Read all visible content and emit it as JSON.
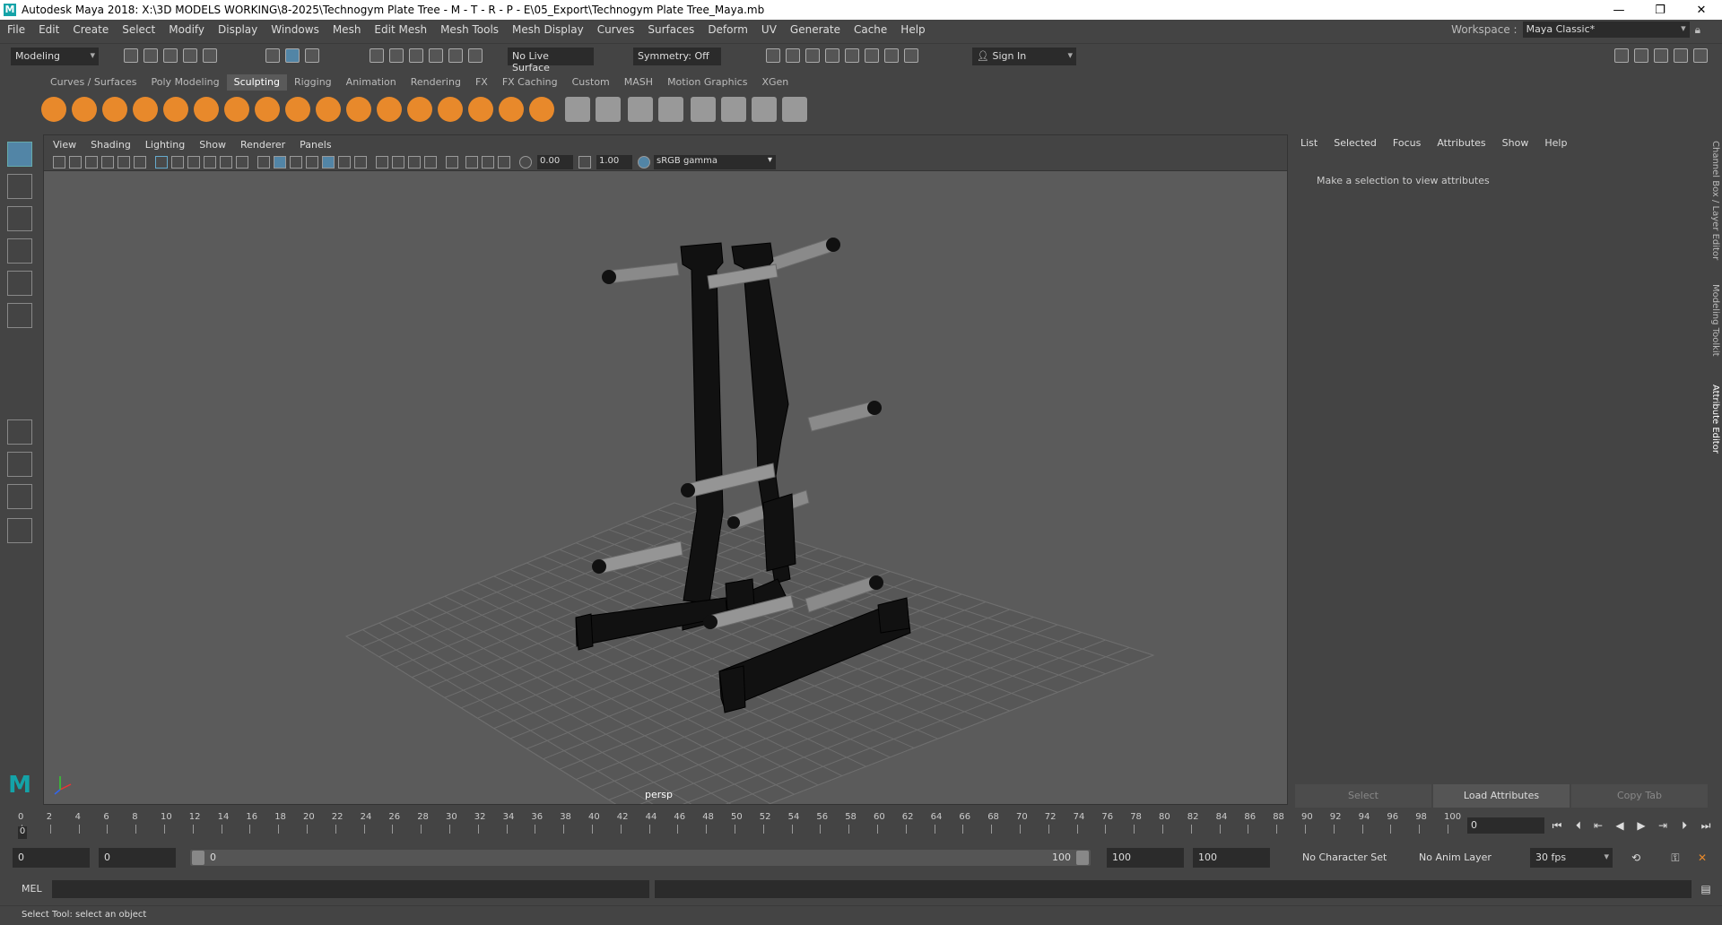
{
  "titlebar": {
    "title": "Autodesk Maya 2018: X:\\3D MODELS WORKING\\8-2025\\Technogym Plate Tree - M - T - R - P - E\\05_Export\\Technogym Plate Tree_Maya.mb",
    "minimize": "—",
    "restore": "❐",
    "close": "✕"
  },
  "menubar": {
    "items": [
      "File",
      "Edit",
      "Create",
      "Select",
      "Modify",
      "Display",
      "Windows",
      "Mesh",
      "Edit Mesh",
      "Mesh Tools",
      "Mesh Display",
      "Curves",
      "Surfaces",
      "Deform",
      "UV",
      "Generate",
      "Cache",
      "Help"
    ],
    "workspace_label": "Workspace :",
    "workspace_value": "Maya Classic*"
  },
  "statusline": {
    "mode": "Modeling",
    "live_surface": "No Live Surface",
    "symmetry": "Symmetry: Off",
    "sign_in": "Sign In"
  },
  "shelf": {
    "tabs": [
      "Curves / Surfaces",
      "Poly Modeling",
      "Sculpting",
      "Rigging",
      "Animation",
      "Rendering",
      "FX",
      "FX Caching",
      "Custom",
      "MASH",
      "Motion Graphics",
      "XGen"
    ],
    "active_tab": "Sculpting"
  },
  "viewport": {
    "menu": [
      "View",
      "Shading",
      "Lighting",
      "Show",
      "Renderer",
      "Panels"
    ],
    "exposure": "0.00",
    "gamma": "1.00",
    "color_space": "sRGB gamma",
    "camera": "persp"
  },
  "attribute_editor": {
    "menu": [
      "List",
      "Selected",
      "Focus",
      "Attributes",
      "Show",
      "Help"
    ],
    "message": "Make a selection to view attributes",
    "buttons": [
      "Select",
      "Load Attributes",
      "Copy Tab"
    ]
  },
  "side_tabs": [
    "Channel Box / Layer Editor",
    "Modeling Toolkit",
    "Attribute Editor"
  ],
  "timeline": {
    "ticks": [
      "0",
      "2",
      "4",
      "6",
      "8",
      "10",
      "12",
      "14",
      "16",
      "18",
      "20",
      "22",
      "24",
      "26",
      "28",
      "30",
      "32",
      "34",
      "36",
      "38",
      "40",
      "42",
      "44",
      "46",
      "48",
      "50",
      "52",
      "54",
      "56",
      "58",
      "60",
      "62",
      "64",
      "66",
      "68",
      "70",
      "72",
      "74",
      "76",
      "78",
      "80",
      "82",
      "84",
      "86",
      "88",
      "90",
      "92",
      "94",
      "96",
      "98",
      "100"
    ],
    "current_frame": "0",
    "current_marker": "0"
  },
  "range": {
    "start": "0",
    "anim_start": "0",
    "slider_start": "0",
    "slider_end": "100",
    "anim_end": "100",
    "end": "100",
    "character_set": "No Character Set",
    "anim_layer": "No Anim Layer",
    "fps": "30 fps"
  },
  "command_line": {
    "label": "MEL"
  },
  "help_line": {
    "text": "Select Tool: select an object"
  },
  "colors": {
    "accent": "#5285a6",
    "maya_logo": "#14a3a8",
    "shelf_orange": "#e8892b"
  }
}
